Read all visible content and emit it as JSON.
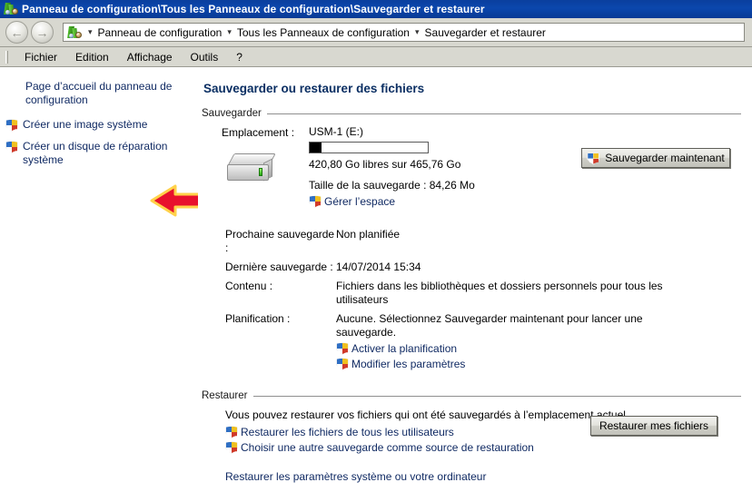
{
  "window": {
    "title": "Panneau de configuration\\Tous les Panneaux de configuration\\Sauvegarder et restaurer",
    "title_icon": "control-panel-icon",
    "titlebar_color": "#0b47ad"
  },
  "navbar": {
    "back_glyph": "←",
    "forward_glyph": "→",
    "address_icon": "control-panel-icon",
    "separator": "▾",
    "crumbs": [
      "Panneau de configuration",
      "Tous les Panneaux de configuration",
      "Sauvegarder et restaurer"
    ]
  },
  "menubar": {
    "items": [
      "Fichier",
      "Edition",
      "Affichage",
      "Outils",
      "?"
    ]
  },
  "sidebar": {
    "home_link": "Page d’accueil du panneau de configuration",
    "links": [
      {
        "label": "Créer une image système",
        "icon": "uac-shield-icon"
      },
      {
        "label": "Créer un disque de réparation système",
        "icon": "uac-shield-icon"
      }
    ],
    "annotation": {
      "type": "red-arrow",
      "color": "#e8112d",
      "outline": "#ffd24a",
      "points_to": "Créer une image système"
    }
  },
  "main": {
    "page_title": "Sauvegarder ou restaurer des fichiers",
    "backup": {
      "group_label": "Sauvegarder",
      "location_label": "Emplacement :",
      "drive_icon": "external-hard-drive-icon",
      "drive_name": "USM-1 (E:)",
      "capacity_bar": {
        "used_percent": 10,
        "fill_color": "#000000",
        "track_color": "#ffffff"
      },
      "free_space_text": "420,80 Go libres sur 465,76 Go",
      "backup_size_text": "Taille de la sauvegarde : 84,26 Mo",
      "manage_space_link": "Gérer l’espace",
      "manage_space_icon": "uac-shield-icon",
      "backup_now_button": "Sauvegarder maintenant",
      "backup_now_icon": "uac-shield-icon",
      "details": [
        {
          "label": "Prochaine sauvegarde :",
          "value": "Non planifiée"
        },
        {
          "label": "Dernière sauvegarde :",
          "value": "14/07/2014 15:34"
        },
        {
          "label": "Contenu :",
          "value": "Fichiers dans les bibliothèques et dossiers personnels pour tous les utilisateurs"
        },
        {
          "label": "Planification :",
          "value": "Aucune. Sélectionnez Sauvegarder maintenant pour lancer une sauvegarde."
        }
      ],
      "schedule_links": [
        {
          "label": "Activer la planification",
          "icon": "uac-shield-icon"
        },
        {
          "label": "Modifier les paramètres",
          "icon": "uac-shield-icon"
        }
      ]
    },
    "restore": {
      "group_label": "Restaurer",
      "description": "Vous pouvez restaurer vos fichiers qui ont été sauvegardés à l’emplacement actuel.",
      "links": [
        {
          "label": "Restaurer les fichiers de tous les utilisateurs",
          "icon": "uac-shield-icon"
        },
        {
          "label": "Choisir une autre sauvegarde comme source de restauration",
          "icon": "uac-shield-icon"
        }
      ],
      "system_restore_link": "Restaurer les paramètres système ou votre ordinateur",
      "restore_button": "Restaurer mes fichiers"
    }
  }
}
